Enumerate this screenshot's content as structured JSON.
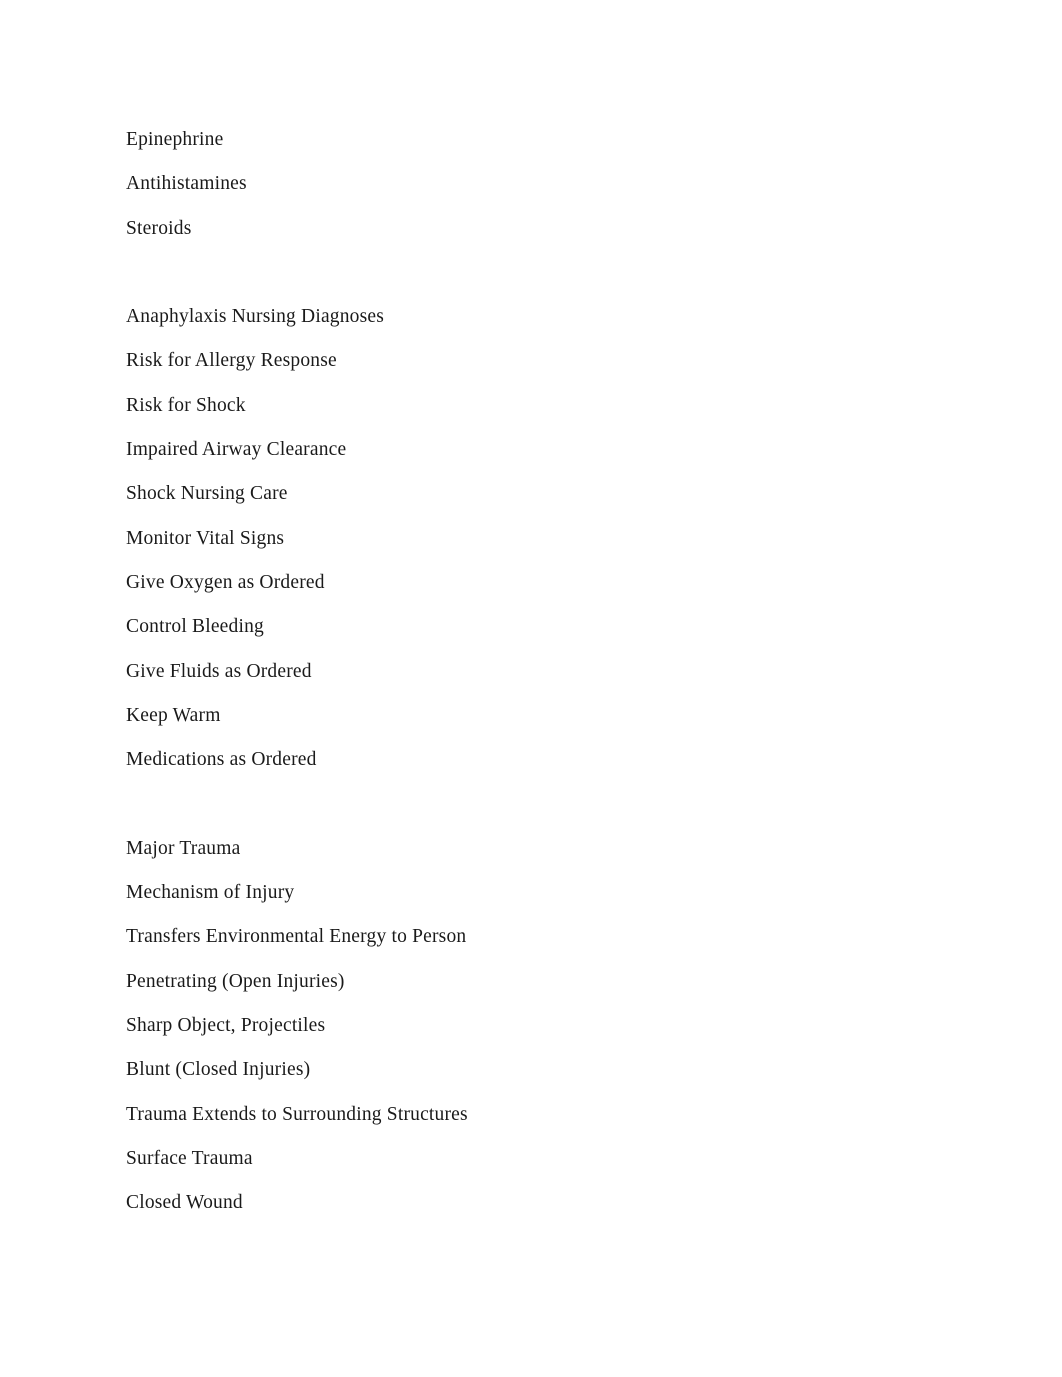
{
  "document": {
    "background_color": "#ffffff",
    "text_color": "#1a1a1a",
    "sections": [
      {
        "name": "anaphylaxis-medications",
        "lines": [
          "Epinephrine",
          "Antihistamines",
          "Steroids"
        ]
      },
      {
        "name": "anaphylaxis-nursing-diagnoses",
        "lines": [
          "Anaphylaxis Nursing Diagnoses",
          "Risk for Allergy Response",
          "Risk for Shock",
          "Impaired Airway Clearance",
          "Shock Nursing Care",
          "Monitor Vital Signs",
          "Give Oxygen as Ordered",
          "Control Bleeding",
          "Give Fluids as Ordered",
          "Keep Warm",
          "Medications as Ordered"
        ]
      },
      {
        "name": "major-trauma",
        "lines": [
          "Major Trauma",
          "Mechanism of Injury",
          "Transfers Environmental Energy to Person",
          "Penetrating (Open Injuries)",
          "Sharp Object, Projectiles",
          "Blunt (Closed Injuries)",
          "Trauma Extends to Surrounding Structures",
          "Surface Trauma",
          "Closed Wound"
        ]
      }
    ]
  }
}
